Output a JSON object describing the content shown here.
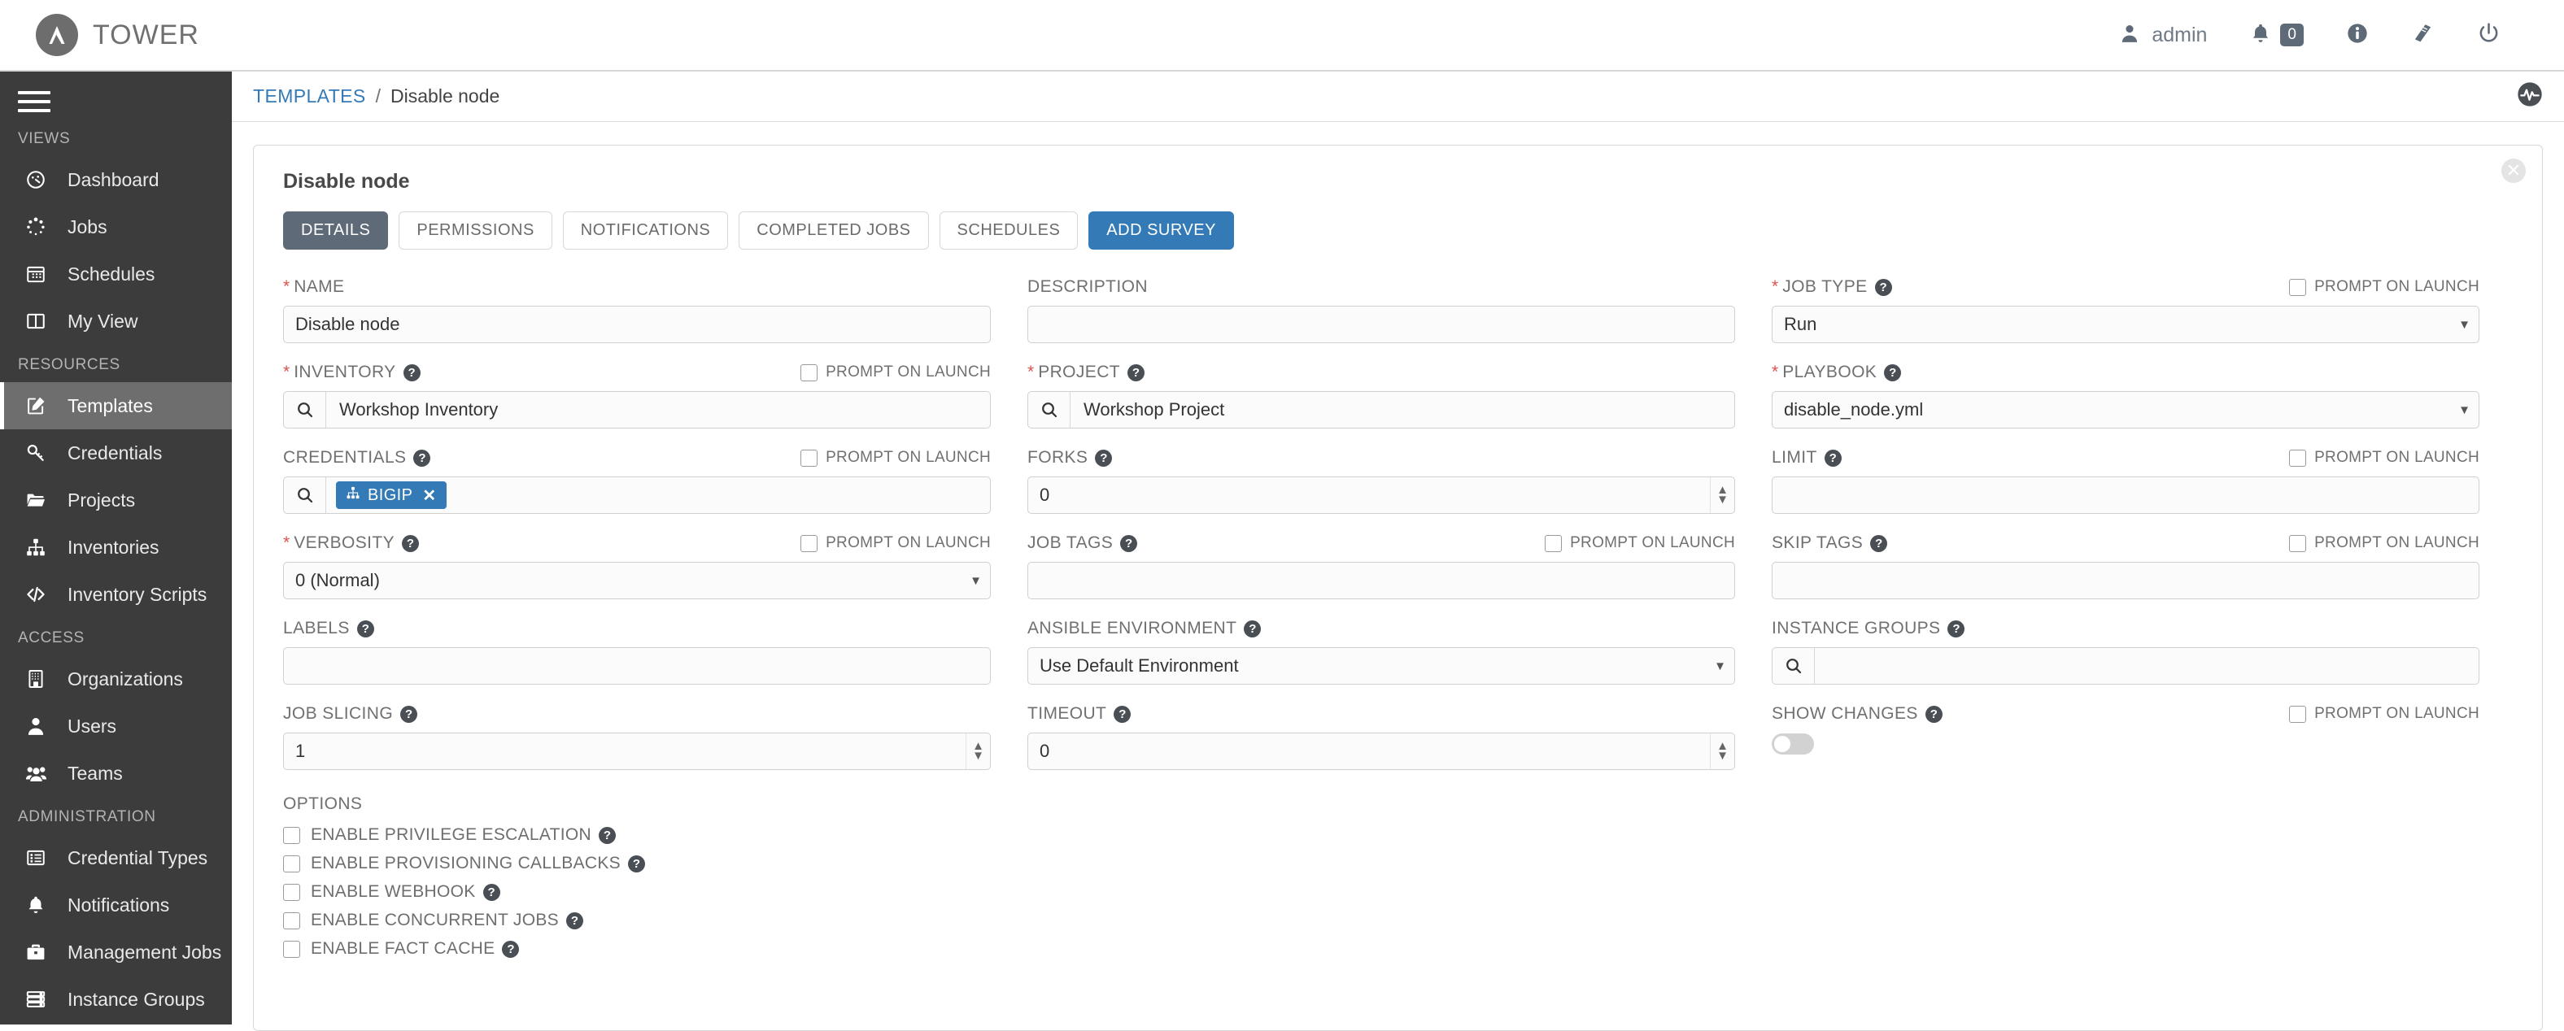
{
  "topbar": {
    "brand": "TOWER",
    "user": "admin",
    "notifications_count": "0",
    "icons": {
      "user": "user-icon",
      "bell": "bell-icon",
      "info": "info-icon",
      "book": "book-icon",
      "power": "power-icon"
    }
  },
  "sidebar": {
    "sections": [
      {
        "title": "VIEWS",
        "items": [
          {
            "label": "Dashboard",
            "icon": "dashboard-icon",
            "active": false
          },
          {
            "label": "Jobs",
            "icon": "jobs-icon",
            "active": false
          },
          {
            "label": "Schedules",
            "icon": "calendar-icon",
            "active": false
          },
          {
            "label": "My View",
            "icon": "columns-icon",
            "active": false
          }
        ]
      },
      {
        "title": "RESOURCES",
        "items": [
          {
            "label": "Templates",
            "icon": "template-edit-icon",
            "active": true
          },
          {
            "label": "Credentials",
            "icon": "key-icon",
            "active": false
          },
          {
            "label": "Projects",
            "icon": "folder-icon",
            "active": false
          },
          {
            "label": "Inventories",
            "icon": "sitemap-icon",
            "active": false
          },
          {
            "label": "Inventory Scripts",
            "icon": "code-icon",
            "active": false
          }
        ]
      },
      {
        "title": "ACCESS",
        "items": [
          {
            "label": "Organizations",
            "icon": "building-icon",
            "active": false
          },
          {
            "label": "Users",
            "icon": "user-icon",
            "active": false
          },
          {
            "label": "Teams",
            "icon": "users-icon",
            "active": false
          }
        ]
      },
      {
        "title": "ADMINISTRATION",
        "items": [
          {
            "label": "Credential Types",
            "icon": "list-icon",
            "active": false
          },
          {
            "label": "Notifications",
            "icon": "bell-icon",
            "active": false
          },
          {
            "label": "Management Jobs",
            "icon": "briefcase-icon",
            "active": false
          },
          {
            "label": "Instance Groups",
            "icon": "server-icon",
            "active": false
          }
        ]
      }
    ]
  },
  "breadcrumb": {
    "root": "TEMPLATES",
    "separator": "/",
    "current": "Disable node",
    "activity_icon": "activity-stream-icon"
  },
  "card": {
    "title": "Disable node",
    "close_label": "✕",
    "tabs": [
      {
        "label": "DETAILS",
        "style": "active"
      },
      {
        "label": "PERMISSIONS",
        "style": "normal"
      },
      {
        "label": "NOTIFICATIONS",
        "style": "normal"
      },
      {
        "label": "COMPLETED JOBS",
        "style": "normal"
      },
      {
        "label": "SCHEDULES",
        "style": "normal"
      },
      {
        "label": "ADD SURVEY",
        "style": "primary"
      }
    ]
  },
  "prompt_on_launch_label": "PROMPT ON LAUNCH",
  "fields": {
    "name": {
      "label": "NAME",
      "value": "Disable node",
      "placeholder": ""
    },
    "description": {
      "label": "DESCRIPTION",
      "value": "",
      "placeholder": ""
    },
    "job_type": {
      "label": "JOB TYPE",
      "value": "Run"
    },
    "inventory": {
      "label": "INVENTORY",
      "value": "Workshop Inventory"
    },
    "project": {
      "label": "PROJECT",
      "value": "Workshop Project"
    },
    "playbook": {
      "label": "PLAYBOOK",
      "value": "disable_node.yml"
    },
    "credentials": {
      "label": "CREDENTIALS",
      "tag": "BIGIP",
      "tag_icon": "sitemap-icon",
      "tag_remove": "✕"
    },
    "forks": {
      "label": "FORKS",
      "value": "0"
    },
    "limit": {
      "label": "LIMIT",
      "value": ""
    },
    "verbosity": {
      "label": "VERBOSITY",
      "value": "0 (Normal)"
    },
    "job_tags": {
      "label": "JOB TAGS",
      "value": ""
    },
    "skip_tags": {
      "label": "SKIP TAGS",
      "value": ""
    },
    "labels": {
      "label": "LABELS",
      "value": ""
    },
    "ansible_environment": {
      "label": "ANSIBLE ENVIRONMENT",
      "value": "Use Default Environment"
    },
    "instance_groups": {
      "label": "INSTANCE GROUPS",
      "value": ""
    },
    "job_slicing": {
      "label": "JOB SLICING",
      "value": "1"
    },
    "timeout": {
      "label": "TIMEOUT",
      "value": "0"
    },
    "show_changes": {
      "label": "SHOW CHANGES",
      "state": "off"
    }
  },
  "options": {
    "title": "OPTIONS",
    "items": [
      {
        "label": "ENABLE PRIVILEGE ESCALATION",
        "checked": false
      },
      {
        "label": "ENABLE PROVISIONING CALLBACKS",
        "checked": false
      },
      {
        "label": "ENABLE WEBHOOK",
        "checked": false
      },
      {
        "label": "ENABLE CONCURRENT JOBS",
        "checked": false
      },
      {
        "label": "ENABLE FACT CACHE",
        "checked": false
      }
    ]
  },
  "colors": {
    "primary_blue": "#337ab7",
    "sidebar_bg": "#3c3c3c",
    "sidebar_active": "#6e6e6e",
    "tab_active": "#5e6a77",
    "required_red": "#d9534f",
    "label_gray": "#707070"
  }
}
